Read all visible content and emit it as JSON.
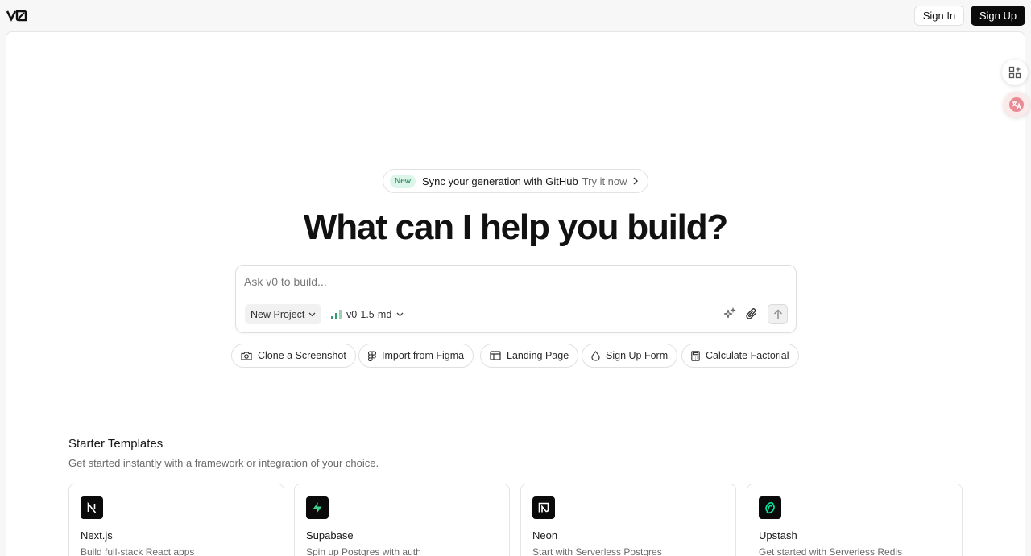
{
  "header": {
    "logo_label": "v0",
    "sign_in_label": "Sign In",
    "sign_up_label": "Sign Up"
  },
  "announcement": {
    "badge": "New",
    "text": "Sync your generation with GitHub",
    "link": "Try it now"
  },
  "headline": "What can I help you build?",
  "prompt": {
    "placeholder": "Ask v0 to build...",
    "project_select": "New Project",
    "model_select": "v0-1.5-md"
  },
  "suggestions": [
    {
      "label": "Clone a Screenshot",
      "icon": "camera-icon"
    },
    {
      "label": "Import from Figma",
      "icon": "figma-icon"
    },
    {
      "label": "Landing Page",
      "icon": "layout-icon"
    },
    {
      "label": "Sign Up Form",
      "icon": "droplet-icon"
    },
    {
      "label": "Calculate Factorial",
      "icon": "calculator-icon"
    }
  ],
  "starter_templates": {
    "title": "Starter Templates",
    "subtitle": "Get started instantly with a framework or integration of your choice.",
    "cards": [
      {
        "name": "Next.js",
        "desc": "Build full-stack React apps",
        "icon": "nextjs-icon",
        "accent": "#ffffff"
      },
      {
        "name": "Supabase",
        "desc": "Spin up Postgres with auth",
        "icon": "supabase-icon",
        "accent": "#3ecf8e"
      },
      {
        "name": "Neon",
        "desc": "Start with Serverless Postgres",
        "icon": "neon-icon",
        "accent": "#34d59a"
      },
      {
        "name": "Upstash",
        "desc": "Get started with Serverless Redis",
        "icon": "upstash-icon",
        "accent": "#00e9a3"
      }
    ]
  },
  "colors": {
    "primary_button": "#0a0a0a",
    "badge_bg": "#dcf5ea",
    "badge_text": "#1f7a52",
    "page_bg": "#f7f7f7"
  }
}
